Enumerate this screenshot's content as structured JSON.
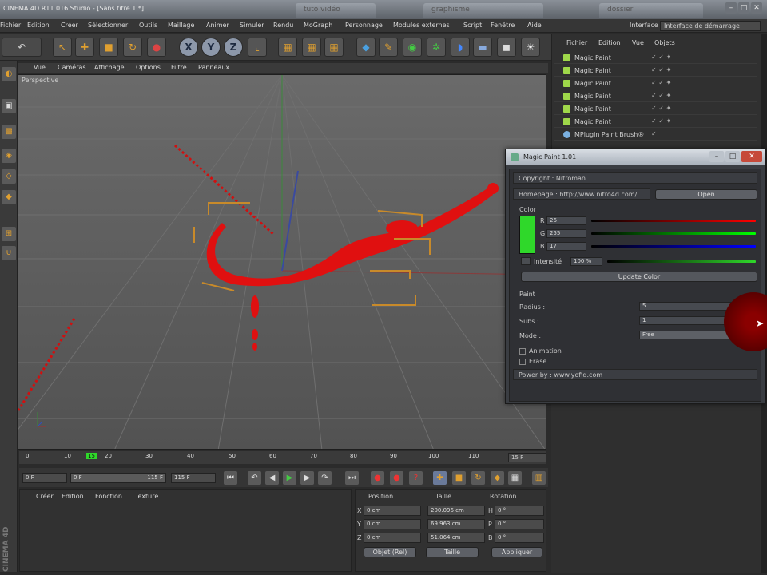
{
  "window": {
    "title": "CINEMA 4D R11.016 Studio - [Sans titre 1 *]",
    "tabs": [
      "tuto vidéo",
      "graphisme",
      "dossier"
    ],
    "controls": [
      "–",
      "□",
      "✕"
    ]
  },
  "menubar": {
    "items": [
      "Fichier",
      "Edition",
      "Créer",
      "Sélectionner",
      "Outils",
      "Maillage",
      "Animer",
      "Simuler",
      "Rendu",
      "MoGraph",
      "Personnage",
      "Modules externes",
      "Script",
      "Fenêtre",
      "Aide"
    ],
    "interface_label": "Interface",
    "interface_value": "Interface de démarrage"
  },
  "toolbar": {
    "x": "X",
    "y": "Y",
    "z": "Z"
  },
  "viewport": {
    "menu": [
      "Vue",
      "Caméras",
      "Affichage",
      "Options",
      "Filtre",
      "Panneaux"
    ],
    "label": "Perspective"
  },
  "timeline": {
    "ticks": [
      "0",
      "10",
      "15",
      "20",
      "30",
      "40",
      "50",
      "60",
      "70",
      "80",
      "90",
      "100",
      "110"
    ],
    "current_frame": "15 F",
    "start_field": "0 F",
    "end_field": "115 F",
    "range_min": "0 F",
    "range_max": "115 F"
  },
  "material_panel": {
    "menu": [
      "Créer",
      "Edition",
      "Fonction",
      "Texture"
    ],
    "vertical_label": "CINEMA 4D"
  },
  "coord_panel": {
    "headers": [
      "Position",
      "Taille",
      "Rotation"
    ],
    "rows": [
      {
        "axis": "X",
        "pos": "0 cm",
        "size": "200.096 cm",
        "rot_axis": "H",
        "rot": "0 °"
      },
      {
        "axis": "Y",
        "pos": "0 cm",
        "size": "69.963 cm",
        "rot_axis": "P",
        "rot": "0 °"
      },
      {
        "axis": "Z",
        "pos": "0 cm",
        "size": "51.064 cm",
        "rot_axis": "B",
        "rot": "0 °"
      }
    ],
    "mode": "Objet (Rel)",
    "size_mode": "Taille",
    "apply": "Appliquer"
  },
  "object_manager": {
    "menu": [
      "Fichier",
      "Edition",
      "Vue",
      "Objets"
    ],
    "objects": [
      "Magic Paint",
      "Magic Paint",
      "Magic Paint",
      "Magic Paint",
      "Magic Paint",
      "Magic Paint"
    ],
    "last_object": "MPlugin Paint Brush®"
  },
  "dialog": {
    "title": "Magic Paint 1.01",
    "copyright": "Copyright : Nitroman",
    "homepage_label": "Homepage : http://www.nitro4d.com/",
    "open_button": "Open",
    "color_section": "Color",
    "r_label": "R",
    "r_value": "26",
    "g_label": "G",
    "g_value": "255",
    "b_label": "B",
    "b_value": "17",
    "swatch_color": "#2fd82a",
    "intensity_label": "Intensité",
    "intensity_value": "100 %",
    "update_button": "Update Color",
    "paint_section": "Paint",
    "radius_label": "Radius :",
    "radius_value": "5",
    "subs_label": "Subs :",
    "subs_value": "1",
    "mode_label": "Mode :",
    "mode_value": "Free",
    "animation_label": "Animation",
    "erase_label": "Erase",
    "powered_by": "Power by : www.yofid.com"
  }
}
